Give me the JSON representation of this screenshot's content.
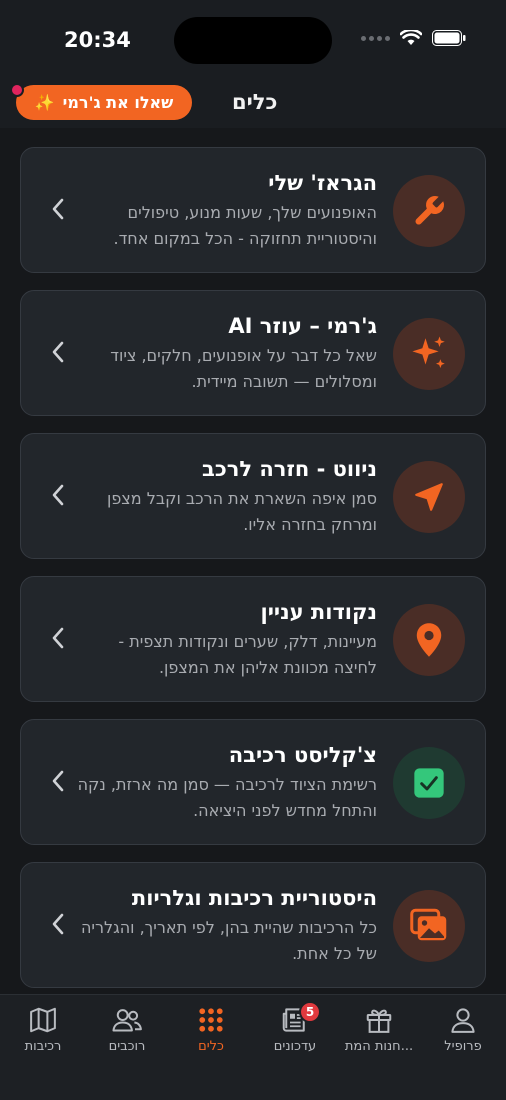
{
  "status_bar": {
    "time": "20:34"
  },
  "header": {
    "title": "כלים",
    "ask_button": "שאלו את ג'רמי",
    "sparkle": "✨"
  },
  "cards": [
    {
      "title": "הגראז' שלי",
      "desc": "האופנועים שלך, שעות מנוע, טיפולים והיסטוריית תחזוקה - הכל במקום אחד.",
      "icon": "wrench-icon"
    },
    {
      "title": "ג'רמי – עוזר AI",
      "desc": "שאל כל דבר על אופנועים, חלקים, ציוד ומסלולים — תשובה מיידית.",
      "icon": "sparkles-icon"
    },
    {
      "title": "ניווט - חזרה לרכב",
      "desc": "סמן איפה השארת את הרכב וקבל מצפן ומרחק בחזרה אליו.",
      "icon": "navigation-icon"
    },
    {
      "title": "נקודות עניין",
      "desc": "מעיינות, דלק, שערים ונקודות תצפית - לחיצה מכוונת אליהן את המצפן.",
      "icon": "map-pin-icon"
    },
    {
      "title": "צ'קליסט רכיבה",
      "desc": "רשימת הציוד לרכיבה — סמן מה ארזת, נקה והתחל מחדש לפני היציאה.",
      "icon": "checkbox-icon"
    },
    {
      "title": "היסטוריית רכיבות וגלריות",
      "desc": "כל הרכיבות שהיית בהן, לפי תאריך, והגלריה של כל אחת.",
      "icon": "gallery-icon"
    }
  ],
  "tabs": [
    {
      "label": "פרופיל",
      "icon": "profile-icon"
    },
    {
      "label": "חנות המת...",
      "icon": "gift-icon"
    },
    {
      "label": "עדכונים",
      "icon": "news-icon",
      "badge": "5"
    },
    {
      "label": "כלים",
      "icon": "grid-icon",
      "active": true
    },
    {
      "label": "רוכבים",
      "icon": "users-icon"
    },
    {
      "label": "רכיבות",
      "icon": "map-icon"
    }
  ],
  "colors": {
    "accent": "#f26522",
    "background": "#16181b",
    "card": "#22262b",
    "badge": "#e0393e",
    "check": "#34c77b"
  }
}
